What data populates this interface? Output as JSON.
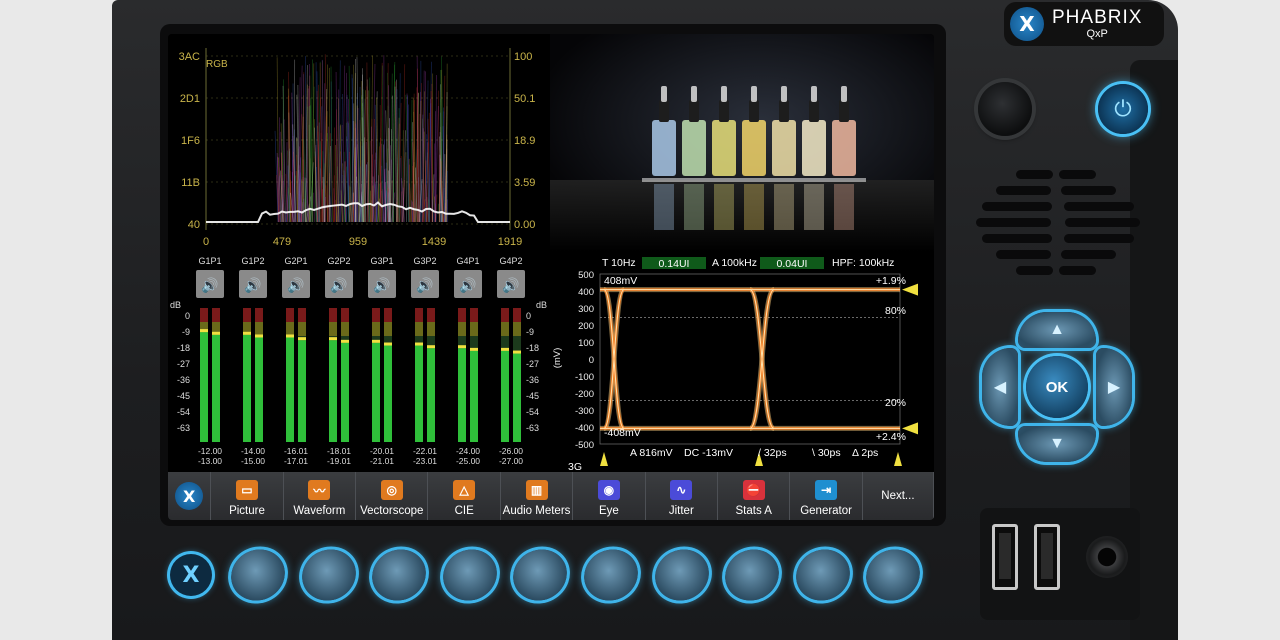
{
  "brand": {
    "name": "PHABRIX",
    "model": "QxP"
  },
  "waveform": {
    "left_ticks": [
      "3AC",
      "2D1",
      "1F6",
      "11B",
      "40"
    ],
    "right_ticks": [
      "100",
      "50.1",
      "18.9",
      "3.59",
      "0.00"
    ],
    "x_ticks": [
      "0",
      "479",
      "959",
      "1439",
      "1919"
    ],
    "mode": "RGB"
  },
  "audio": {
    "channels": [
      {
        "label": "G1P1",
        "l": "-12.00",
        "r": "-13.00",
        "levelL": 0.82,
        "levelR": 0.8
      },
      {
        "label": "G1P2",
        "l": "-14.00",
        "r": "-15.00",
        "levelL": 0.8,
        "levelR": 0.78
      },
      {
        "label": "G2P1",
        "l": "-16.01",
        "r": "-17.01",
        "levelL": 0.78,
        "levelR": 0.76
      },
      {
        "label": "G2P2",
        "l": "-18.01",
        "r": "-19.01",
        "levelL": 0.76,
        "levelR": 0.74
      },
      {
        "label": "G3P1",
        "l": "-20.01",
        "r": "-21.01",
        "levelL": 0.74,
        "levelR": 0.72
      },
      {
        "label": "G3P2",
        "l": "-22.01",
        "r": "-23.01",
        "levelL": 0.72,
        "levelR": 0.7
      },
      {
        "label": "G4P1",
        "l": "-24.00",
        "r": "-25.00",
        "levelL": 0.7,
        "levelR": 0.68
      },
      {
        "label": "G4P2",
        "l": "-26.00",
        "r": "-27.00",
        "levelL": 0.68,
        "levelR": 0.66
      }
    ],
    "db_label": "dB",
    "scale": [
      "0",
      "-9",
      "-18",
      "-27",
      "-36",
      "-45",
      "-54",
      "-63"
    ]
  },
  "eye": {
    "t_filter": "T 10Hz",
    "t_value": "0.14UI",
    "a_filter": "A 100kHz",
    "a_value": "0.04UI",
    "hpf": "HPF: 100kHz",
    "y_ticks": [
      "500",
      "400",
      "300",
      "200",
      "100",
      "0",
      "-100",
      "-200",
      "-300",
      "-400",
      "-500"
    ],
    "y_unit": "(mV)",
    "top_mv": "408mV",
    "bottom_mv": "-408mV",
    "pct_top": "+1.9%",
    "pct_80": "80%",
    "pct_20": "20%",
    "pct_bottom": "+2.4%",
    "amp": "A 816mV",
    "dc": "DC -13mV",
    "rise": "/ 32ps",
    "fall": "\\ 30ps",
    "delta": "Δ 2ps",
    "rate": "3G"
  },
  "toolbar": {
    "buttons": [
      {
        "label": "Picture",
        "color": "#e07a1f"
      },
      {
        "label": "Waveform",
        "color": "#e07a1f"
      },
      {
        "label": "Vectorscope",
        "color": "#e07a1f"
      },
      {
        "label": "CIE",
        "color": "#e07a1f"
      },
      {
        "label": "Audio Meters",
        "color": "#e07a1f"
      },
      {
        "label": "Eye",
        "color": "#4b4bd8"
      },
      {
        "label": "Jitter",
        "color": "#4b4bd8"
      },
      {
        "label": "Stats A",
        "color": "#d8323c"
      },
      {
        "label": "Generator",
        "color": "#1f8fd0"
      }
    ],
    "next": "Next..."
  },
  "dpad": {
    "ok": "OK"
  }
}
